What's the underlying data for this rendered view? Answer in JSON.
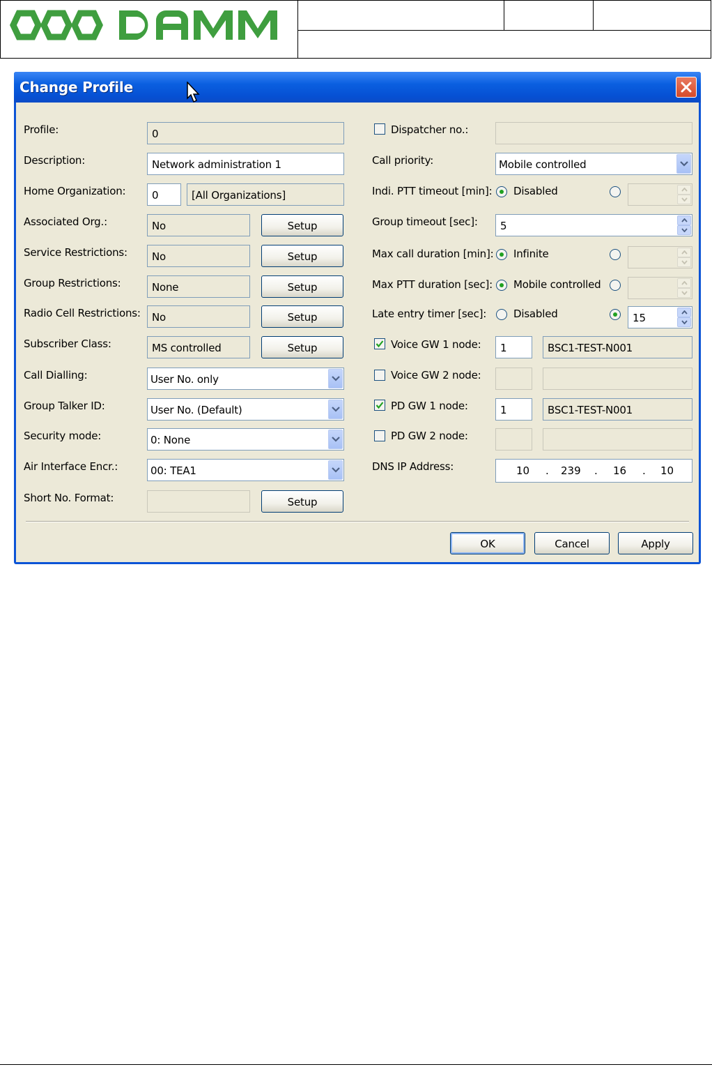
{
  "document": {
    "logo_text": "DAMM"
  },
  "dialog": {
    "title": "Change Profile",
    "left": {
      "profile_label": "Profile:",
      "profile_value": "0",
      "description_label": "Description:",
      "description_value": "Network administration 1",
      "home_org_label": "Home Organization:",
      "home_org_number": "0",
      "home_org_name": "[All Organizations]",
      "assoc_org_label": "Associated Org.:",
      "assoc_org_value": "No",
      "service_restr_label": "Service Restrictions:",
      "service_restr_value": "No",
      "group_restr_label": "Group Restrictions:",
      "group_restr_value": "None",
      "radio_cell_label": "Radio Cell Restrictions:",
      "radio_cell_value": "No",
      "subscriber_class_label": "Subscriber Class:",
      "subscriber_class_value": "MS controlled",
      "call_dialling_label": "Call Dialling:",
      "call_dialling_value": "User No. only",
      "group_talker_label": "Group Talker ID:",
      "group_talker_value": "User No. (Default)",
      "security_mode_label": "Security mode:",
      "security_mode_value": "0: None",
      "air_encr_label": "Air Interface Encr.:",
      "air_encr_value": "00: TEA1",
      "short_no_label": "Short No. Format:",
      "short_no_value": "",
      "setup_label": "Setup"
    },
    "right": {
      "dispatcher_label": "Dispatcher no.:",
      "dispatcher_checked": false,
      "dispatcher_value": "",
      "call_priority_label": "Call priority:",
      "call_priority_value": "Mobile controlled",
      "indi_ptt_label": "Indi. PTT timeout [min]:",
      "indi_ptt_option": "Disabled",
      "group_timeout_label": "Group timeout [sec]:",
      "group_timeout_value": "5",
      "max_call_label": "Max call duration [min]:",
      "max_call_option": "Infinite",
      "max_ptt_label": "Max PTT duration [sec]:",
      "max_ptt_option": "Mobile controlled",
      "late_entry_label": "Late entry timer [sec]:",
      "late_entry_option": "Disabled",
      "late_entry_value": "15",
      "voice_gw1_label": "Voice GW 1 node:",
      "voice_gw1_checked": true,
      "voice_gw1_number": "1",
      "voice_gw1_name": "BSC1-TEST-N001",
      "voice_gw2_label": "Voice GW 2 node:",
      "voice_gw2_checked": false,
      "pd_gw1_label": "PD GW 1 node:",
      "pd_gw1_checked": true,
      "pd_gw1_number": "1",
      "pd_gw1_name": "BSC1-TEST-N001",
      "pd_gw2_label": "PD GW 2 node:",
      "pd_gw2_checked": false,
      "dns_label": "DNS IP Address:",
      "dns_octets": [
        "10",
        "239",
        "16",
        "10"
      ],
      "dns_separator": "."
    },
    "buttons": {
      "ok": "OK",
      "cancel": "Cancel",
      "apply": "Apply"
    }
  }
}
